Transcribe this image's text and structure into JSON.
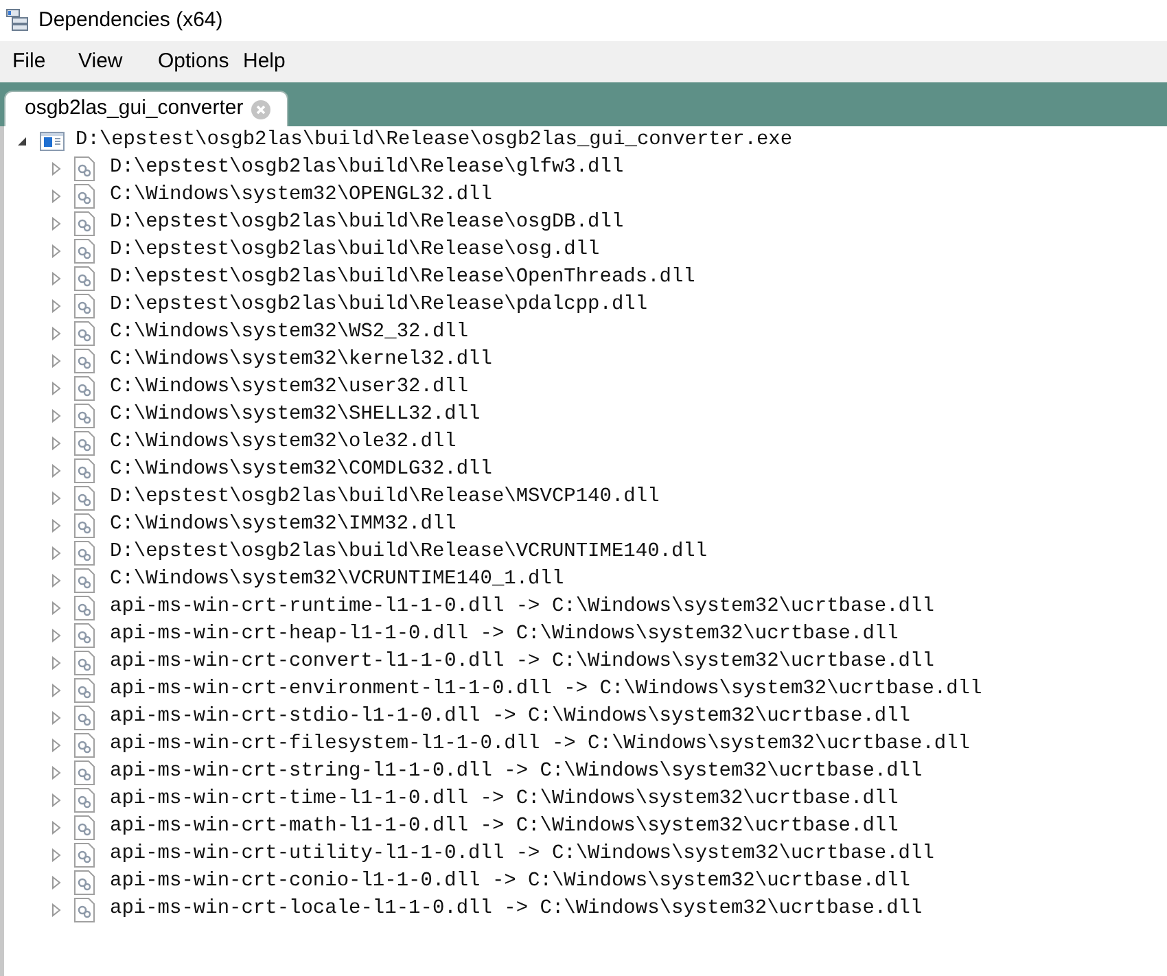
{
  "window": {
    "title": "Dependencies (x64)"
  },
  "menu": [
    "File",
    "View",
    "Options",
    "Help"
  ],
  "tabs": [
    {
      "label": "osgb2las_gui_converter",
      "selected": true
    }
  ],
  "tree": [
    {
      "label": "D:\\epstest\\osgb2las\\build\\Release\\osgb2las_gui_converter.exe",
      "kind": "exe",
      "expanded": true,
      "children": [
        {
          "label": "D:\\epstest\\osgb2las\\build\\Release\\glfw3.dll",
          "kind": "dll",
          "expanded": false
        },
        {
          "label": "C:\\Windows\\system32\\OPENGL32.dll",
          "kind": "dll",
          "expanded": false
        },
        {
          "label": "D:\\epstest\\osgb2las\\build\\Release\\osgDB.dll",
          "kind": "dll",
          "expanded": false
        },
        {
          "label": "D:\\epstest\\osgb2las\\build\\Release\\osg.dll",
          "kind": "dll",
          "expanded": false
        },
        {
          "label": "D:\\epstest\\osgb2las\\build\\Release\\OpenThreads.dll",
          "kind": "dll",
          "expanded": false
        },
        {
          "label": "D:\\epstest\\osgb2las\\build\\Release\\pdalcpp.dll",
          "kind": "dll",
          "expanded": false
        },
        {
          "label": "C:\\Windows\\system32\\WS2_32.dll",
          "kind": "dll",
          "expanded": false
        },
        {
          "label": "C:\\Windows\\system32\\kernel32.dll",
          "kind": "dll",
          "expanded": false
        },
        {
          "label": "C:\\Windows\\system32\\user32.dll",
          "kind": "dll",
          "expanded": false
        },
        {
          "label": "C:\\Windows\\system32\\SHELL32.dll",
          "kind": "dll",
          "expanded": false
        },
        {
          "label": "C:\\Windows\\system32\\ole32.dll",
          "kind": "dll",
          "expanded": false
        },
        {
          "label": "C:\\Windows\\system32\\COMDLG32.dll",
          "kind": "dll",
          "expanded": false
        },
        {
          "label": "D:\\epstest\\osgb2las\\build\\Release\\MSVCP140.dll",
          "kind": "dll",
          "expanded": false
        },
        {
          "label": "C:\\Windows\\system32\\IMM32.dll",
          "kind": "dll",
          "expanded": false
        },
        {
          "label": "D:\\epstest\\osgb2las\\build\\Release\\VCRUNTIME140.dll",
          "kind": "dll",
          "expanded": false
        },
        {
          "label": "C:\\Windows\\system32\\VCRUNTIME140_1.dll",
          "kind": "dll",
          "expanded": false
        },
        {
          "label": "api-ms-win-crt-runtime-l1-1-0.dll -> C:\\Windows\\system32\\ucrtbase.dll",
          "kind": "dll",
          "expanded": false
        },
        {
          "label": "api-ms-win-crt-heap-l1-1-0.dll -> C:\\Windows\\system32\\ucrtbase.dll",
          "kind": "dll",
          "expanded": false
        },
        {
          "label": "api-ms-win-crt-convert-l1-1-0.dll -> C:\\Windows\\system32\\ucrtbase.dll",
          "kind": "dll",
          "expanded": false
        },
        {
          "label": "api-ms-win-crt-environment-l1-1-0.dll -> C:\\Windows\\system32\\ucrtbase.dll",
          "kind": "dll",
          "expanded": false
        },
        {
          "label": "api-ms-win-crt-stdio-l1-1-0.dll -> C:\\Windows\\system32\\ucrtbase.dll",
          "kind": "dll",
          "expanded": false
        },
        {
          "label": "api-ms-win-crt-filesystem-l1-1-0.dll -> C:\\Windows\\system32\\ucrtbase.dll",
          "kind": "dll",
          "expanded": false
        },
        {
          "label": "api-ms-win-crt-string-l1-1-0.dll -> C:\\Windows\\system32\\ucrtbase.dll",
          "kind": "dll",
          "expanded": false
        },
        {
          "label": "api-ms-win-crt-time-l1-1-0.dll -> C:\\Windows\\system32\\ucrtbase.dll",
          "kind": "dll",
          "expanded": false
        },
        {
          "label": "api-ms-win-crt-math-l1-1-0.dll -> C:\\Windows\\system32\\ucrtbase.dll",
          "kind": "dll",
          "expanded": false
        },
        {
          "label": "api-ms-win-crt-utility-l1-1-0.dll -> C:\\Windows\\system32\\ucrtbase.dll",
          "kind": "dll",
          "expanded": false
        },
        {
          "label": "api-ms-win-crt-conio-l1-1-0.dll -> C:\\Windows\\system32\\ucrtbase.dll",
          "kind": "dll",
          "expanded": false
        },
        {
          "label": "api-ms-win-crt-locale-l1-1-0.dll -> C:\\Windows\\system32\\ucrtbase.dll",
          "kind": "dll",
          "expanded": false
        }
      ]
    }
  ]
}
